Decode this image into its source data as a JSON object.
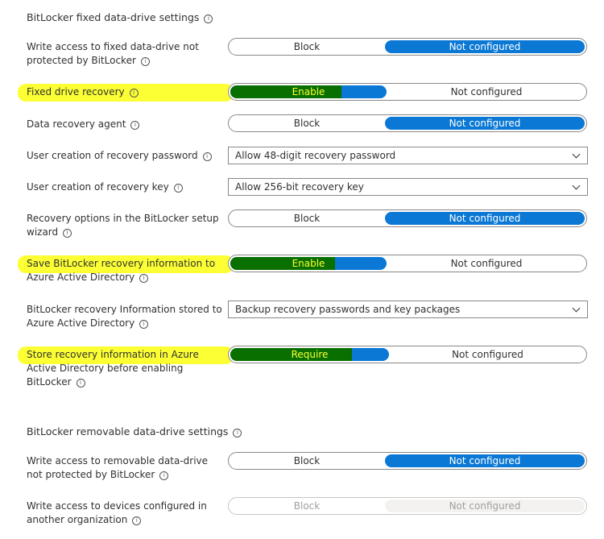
{
  "fixed_section": {
    "title": "BitLocker fixed data-drive settings"
  },
  "removable_section": {
    "title": "BitLocker removable data-drive settings"
  },
  "settings": {
    "write_access_fixed": {
      "label": "Write access to fixed data-drive not protected by BitLocker",
      "option_a": "Block",
      "option_b": "Not configured",
      "selected": "Not configured"
    },
    "fixed_drive_recovery": {
      "label": "Fixed drive recovery",
      "option_a": "Enable",
      "option_b": "Not configured",
      "selected": "Enable"
    },
    "data_recovery_agent": {
      "label": "Data recovery agent",
      "option_a": "Block",
      "option_b": "Not configured",
      "selected": "Not configured"
    },
    "user_recovery_password": {
      "label": "User creation of recovery password",
      "value": "Allow 48-digit recovery password"
    },
    "user_recovery_key": {
      "label": "User creation of recovery key",
      "value": "Allow 256-bit recovery key"
    },
    "recovery_options_wizard": {
      "label": "Recovery options in the BitLocker setup wizard",
      "option_a": "Block",
      "option_b": "Not configured",
      "selected": "Not configured"
    },
    "save_to_aad": {
      "label": "Save BitLocker recovery information to Azure Active Directory",
      "option_a": "Enable",
      "option_b": "Not configured",
      "selected": "Enable"
    },
    "info_stored_aad": {
      "label": "BitLocker recovery Information stored to Azure Active Directory",
      "value": "Backup recovery passwords and key packages"
    },
    "store_before_enabling": {
      "label": "Store recovery information in Azure Active Directory before enabling BitLocker",
      "option_a": "Require",
      "option_b": "Not configured",
      "selected": "Require"
    },
    "write_access_removable": {
      "label": "Write access to removable data-drive not protected by BitLocker",
      "option_a": "Block",
      "option_b": "Not configured",
      "selected": "Not configured"
    },
    "write_access_other_org": {
      "label": "Write access to devices configured in another organization",
      "option_a": "Block",
      "option_b": "Not configured",
      "selected": "Not configured",
      "disabled": true
    }
  },
  "icons": {
    "info": "info-icon",
    "dropdown": "chevron-down-icon"
  },
  "colors": {
    "accent": "#0a78d4",
    "highlight": "#fbff33",
    "green_fill": "#097000"
  }
}
